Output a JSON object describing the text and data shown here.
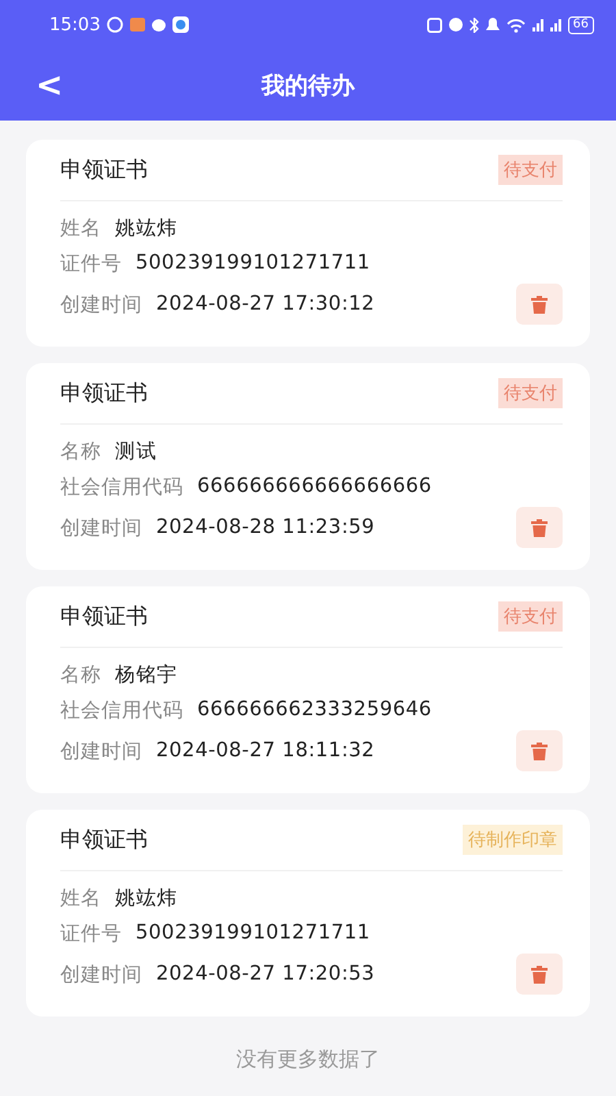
{
  "status_bar": {
    "time": "15:03",
    "battery": "66"
  },
  "header": {
    "back": "<",
    "title": "我的待办"
  },
  "cards": [
    {
      "title": "申领证书",
      "status": {
        "text": "待支付",
        "kind": "payment"
      },
      "fields": [
        {
          "label": "姓名",
          "value": "姚竑炜"
        },
        {
          "label": "证件号",
          "value": "500239199101271711"
        },
        {
          "label": "创建时间",
          "value": "2024-08-27 17:30:12"
        }
      ]
    },
    {
      "title": "申领证书",
      "status": {
        "text": "待支付",
        "kind": "payment"
      },
      "fields": [
        {
          "label": "名称",
          "value": "测试"
        },
        {
          "label": "社会信用代码",
          "value": "666666666666666666"
        },
        {
          "label": "创建时间",
          "value": "2024-08-28 11:23:59"
        }
      ]
    },
    {
      "title": "申领证书",
      "status": {
        "text": "待支付",
        "kind": "payment"
      },
      "fields": [
        {
          "label": "名称",
          "value": "杨铭宇"
        },
        {
          "label": "社会信用代码",
          "value": "666666662333259646"
        },
        {
          "label": "创建时间",
          "value": "2024-08-27 18:11:32"
        }
      ]
    },
    {
      "title": "申领证书",
      "status": {
        "text": "待制作印章",
        "kind": "seal"
      },
      "fields": [
        {
          "label": "姓名",
          "value": "姚竑炜"
        },
        {
          "label": "证件号",
          "value": "500239199101271711"
        },
        {
          "label": "创建时间",
          "value": "2024-08-27 17:20:53"
        }
      ]
    }
  ],
  "footer": "没有更多数据了"
}
